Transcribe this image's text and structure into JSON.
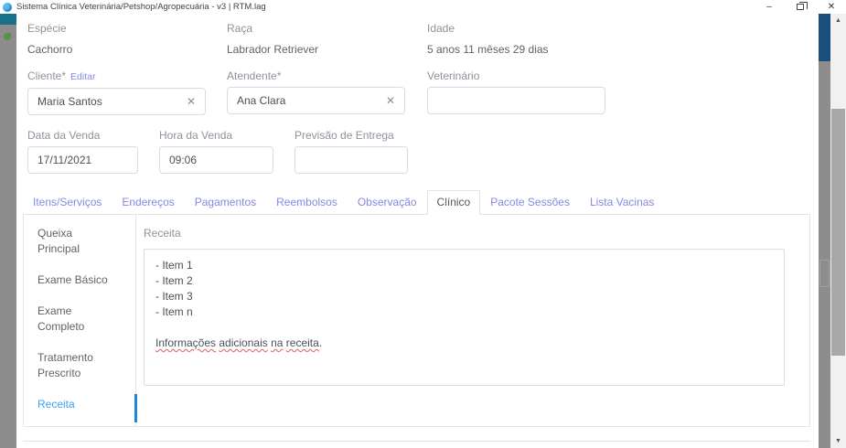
{
  "window": {
    "title": "Sistema Clínica Veterinária/Petshop/Agropecuária - v3 | RTM.lag",
    "minimize_glyph": "–",
    "close_glyph": "✕"
  },
  "form": {
    "especie": {
      "label": "Espécie",
      "value": "Cachorro"
    },
    "raca": {
      "label": "Raça",
      "value": "Labrador Retriever"
    },
    "idade": {
      "label": "Idade",
      "value": "5 anos 11 mêses 29 dias"
    },
    "cliente": {
      "label": "Cliente*",
      "edit_link": "Editar",
      "value": "Maria Santos"
    },
    "atendente": {
      "label": "Atendente*",
      "value": "Ana Clara"
    },
    "veterinario": {
      "label": "Veterinário",
      "value": ""
    },
    "data_venda": {
      "label": "Data da Venda",
      "value": "17/11/2021"
    },
    "hora_venda": {
      "label": "Hora da Venda",
      "value": "09:06"
    },
    "previsao_entrega": {
      "label": "Previsão de Entrega",
      "value": ""
    }
  },
  "tabs": [
    {
      "label": "Itens/Serviços",
      "active": false
    },
    {
      "label": "Endereços",
      "active": false
    },
    {
      "label": "Pagamentos",
      "active": false
    },
    {
      "label": "Reembolsos",
      "active": false
    },
    {
      "label": "Observação",
      "active": false
    },
    {
      "label": "Clínico",
      "active": true
    },
    {
      "label": "Pacote Sessões",
      "active": false
    },
    {
      "label": "Lista Vacinas",
      "active": false
    }
  ],
  "subnav": {
    "items": [
      "Queixa Principal",
      "Exame Básico",
      "Exame Completo",
      "Tratamento Prescrito",
      "Receita"
    ],
    "active": "Receita"
  },
  "receita": {
    "section_label": "Receita",
    "lines": [
      "- Item 1",
      "- Item 2",
      "- Item 3",
      "- Item n"
    ],
    "note_words": [
      "Informações",
      "adicionais",
      "na",
      "receita"
    ],
    "note_period": "."
  },
  "icons": {
    "clear": "✕",
    "scroll_up": "▲",
    "scroll_down": "▼",
    "dim_chevron": "»"
  },
  "colors": {
    "tab_inactive": "#8587e6",
    "edit_link": "#8587e6",
    "subnav_active": "#3aa2f0",
    "active_indicator": "#1d87e0",
    "strip_teal": "#19718a",
    "strip_navy": "#1b4e7e",
    "dim_strip": "#8d8d8d",
    "spellcheck_underline": "#e05d5d"
  }
}
